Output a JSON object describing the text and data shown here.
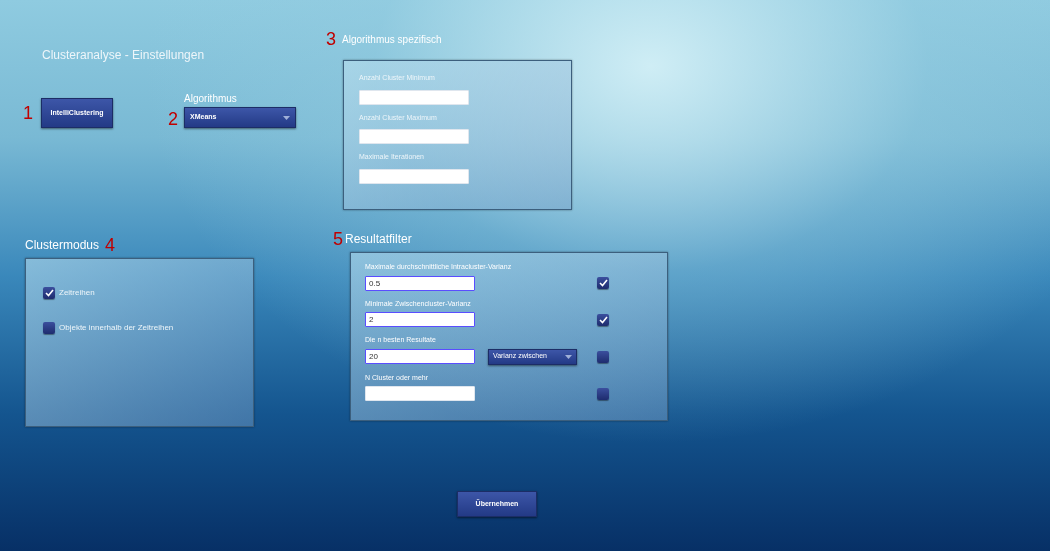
{
  "title": "Clusteranalyse - Einstellungen",
  "intelli_button": {
    "marker": "1",
    "label": "IntelliClustering"
  },
  "algorithm": {
    "marker": "2",
    "label": "Algorithmus",
    "value": "XMeans"
  },
  "specific": {
    "marker": "3",
    "heading": "Algorithmus spezifisch",
    "fields": [
      {
        "label": "Anzahl Cluster Minimum"
      },
      {
        "label": "Anzahl Cluster Maximum"
      },
      {
        "label": "Maximale Iterationen"
      }
    ]
  },
  "cluster_mode": {
    "marker": "4",
    "heading": "Clustermodus",
    "options": [
      {
        "label": "Zeitreihen",
        "checked": true
      },
      {
        "label": "Objekte innerhalb der Zeitreihen",
        "checked": false
      }
    ]
  },
  "result_filter": {
    "marker": "5",
    "heading": "Resultatfilter",
    "filters": [
      {
        "label": "Maximale durchschnittliche Intracluster-Varianz",
        "value": "0.5",
        "checked": true
      },
      {
        "label": "Minimale Zwischencluster-Varianz",
        "value": "2",
        "checked": true
      },
      {
        "label": "Die n besten Resultate",
        "value": "20",
        "dropdown": "Varianz zwischen",
        "checked": false
      },
      {
        "label": "N Cluster oder mehr",
        "checked": false
      }
    ]
  },
  "apply_button": "Übernehmen"
}
